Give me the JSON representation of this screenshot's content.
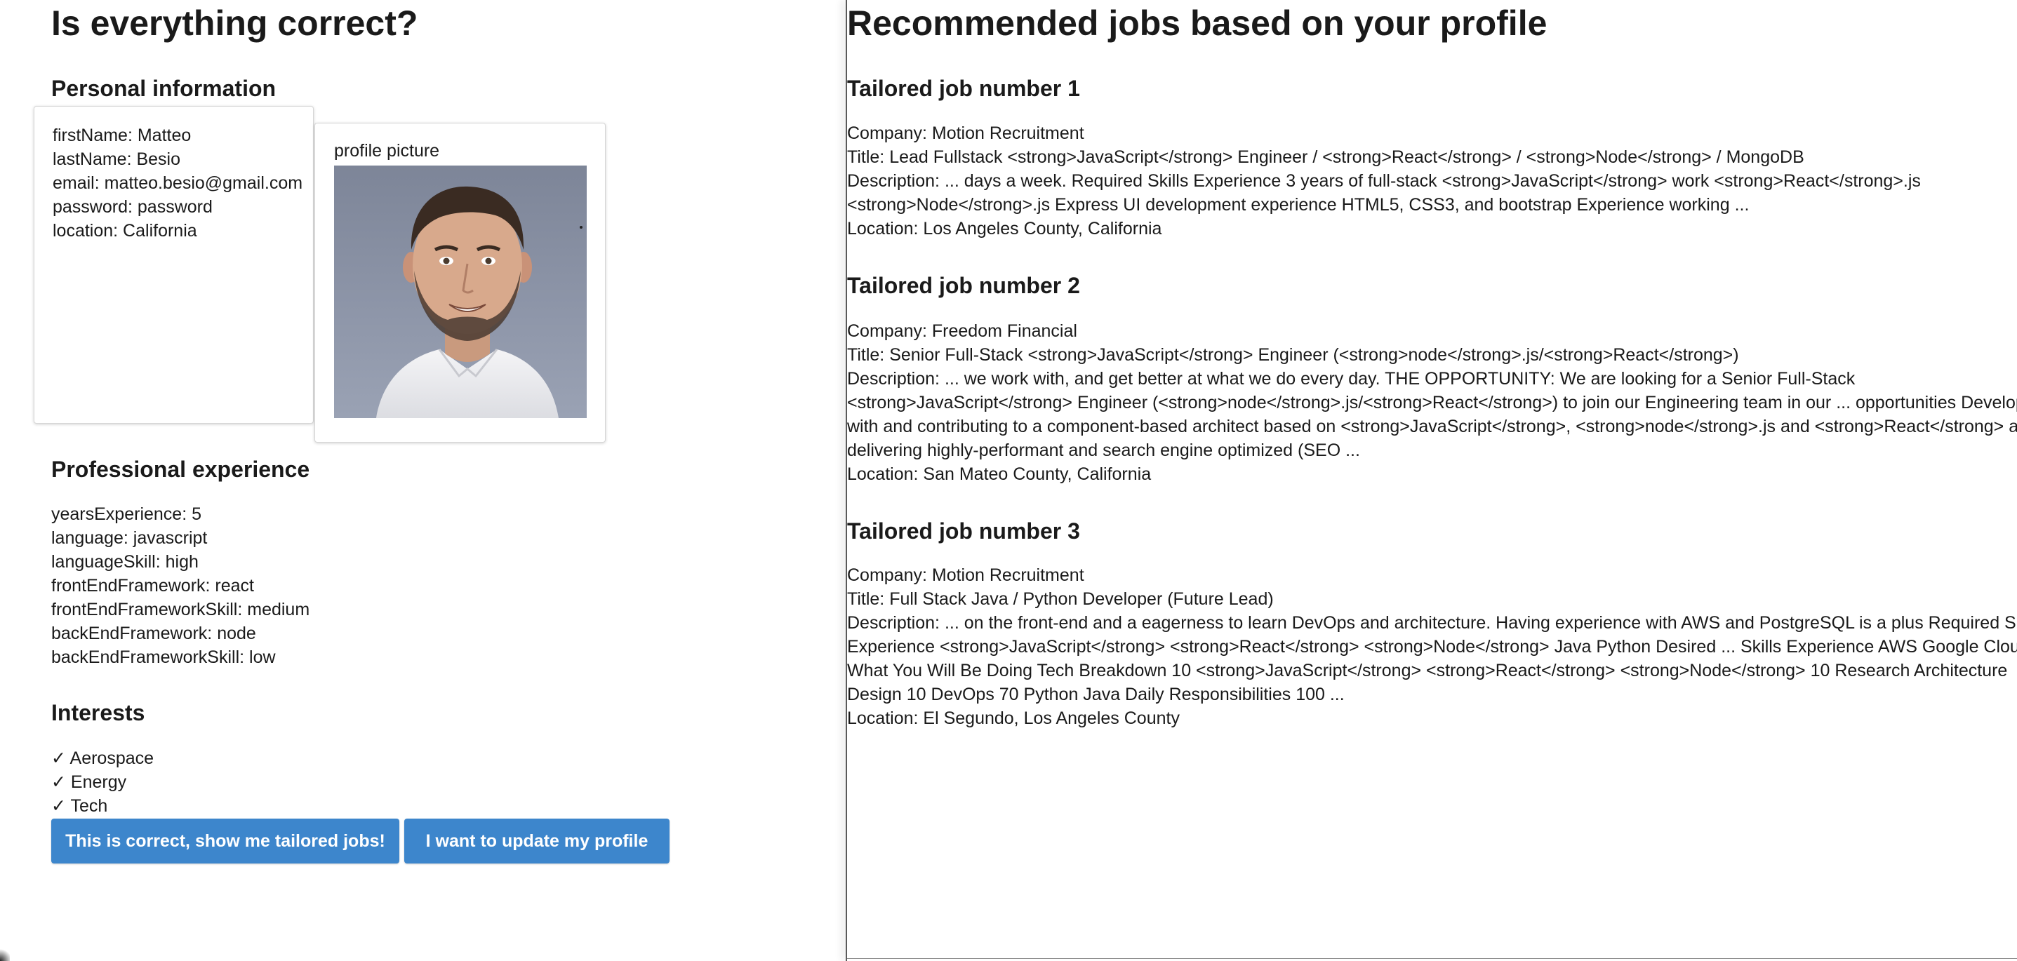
{
  "left": {
    "title": "Is everything correct?",
    "personal": {
      "heading": "Personal information",
      "fields": [
        "firstName: Matteo",
        "lastName: Besio",
        "email: matteo.besio@gmail.com",
        "password: password",
        "location: California"
      ],
      "picture_label": "profile picture"
    },
    "professional": {
      "heading": "Professional experience",
      "fields": [
        "yearsExperience: 5",
        "language: javascript",
        "languageSkill: high",
        "frontEndFramework: react",
        "frontEndFrameworkSkill: medium",
        "backEndFramework: node",
        "backEndFrameworkSkill: low"
      ]
    },
    "interests": {
      "heading": "Interests",
      "items": [
        "✓ Aerospace",
        "✓ Energy",
        "✓ Tech"
      ]
    },
    "buttons": {
      "confirm": "This is correct, show me tailored jobs!",
      "update": "I want to update my profile"
    }
  },
  "right": {
    "title": "Recommended jobs based on your profile",
    "jobs": [
      {
        "heading": "Tailored job number 1",
        "company": "Company: Motion Recruitment",
        "title": "Title: Lead Fullstack <strong>JavaScript</strong> Engineer / <strong>React</strong> / <strong>Node</strong> / MongoDB",
        "description": [
          "Description: ... days a week. Required Skills Experience 3 years of full-stack <strong>JavaScript</strong> work <strong>React</strong>.js",
          "<strong>Node</strong>.js Express UI development experience HTML5, CSS3, and bootstrap Experience working ..."
        ],
        "location": "Location: Los Angeles County, California"
      },
      {
        "heading": "Tailored job number 2",
        "company": "Company: Freedom Financial",
        "title": "Title: Senior Full-Stack <strong>JavaScript</strong> Engineer (<strong>node</strong>.js/<strong>React</strong>)",
        "description": [
          "Description: ... we work with, and get better at what we do every day. THE OPPORTUNITY: We are looking for a Senior Full-Stack",
          "<strong>JavaScript</strong> Engineer (<strong>node</strong>.js/<strong>React</strong>) to join our Engineering team in our ... opportunities Develop",
          "with and contributing to a component-based architect based on <strong>JavaScript</strong>, <strong>node</strong>.js and <strong>React</strong> ar",
          "delivering highly-performant and search engine optimized (SEO ..."
        ],
        "location": "Location: San Mateo County, California"
      },
      {
        "heading": "Tailored job number 3",
        "company": "Company: Motion Recruitment",
        "title": "Title: Full Stack Java / Python Developer (Future Lead)",
        "description": [
          "Description: ... on the front-end and a eagerness to learn DevOps and architecture. Having experience with AWS and PostgreSQL is a plus Required Skills",
          "Experience <strong>JavaScript</strong> <strong>React</strong> <strong>Node</strong> Java Python Desired ... Skills Experience AWS Google Cloud",
          "What You Will Be Doing Tech Breakdown 10 <strong>JavaScript</strong> <strong>React</strong> <strong>Node</strong> 10 Research Architecture",
          "Design 10 DevOps 70 Python Java Daily Responsibilities 100 ..."
        ],
        "location": "Location: El Segundo, Los Angeles County"
      }
    ]
  },
  "colors": {
    "button_blue": "#3d86cc",
    "text": "#1a1a1a",
    "photo_background": "#8a92a5"
  }
}
